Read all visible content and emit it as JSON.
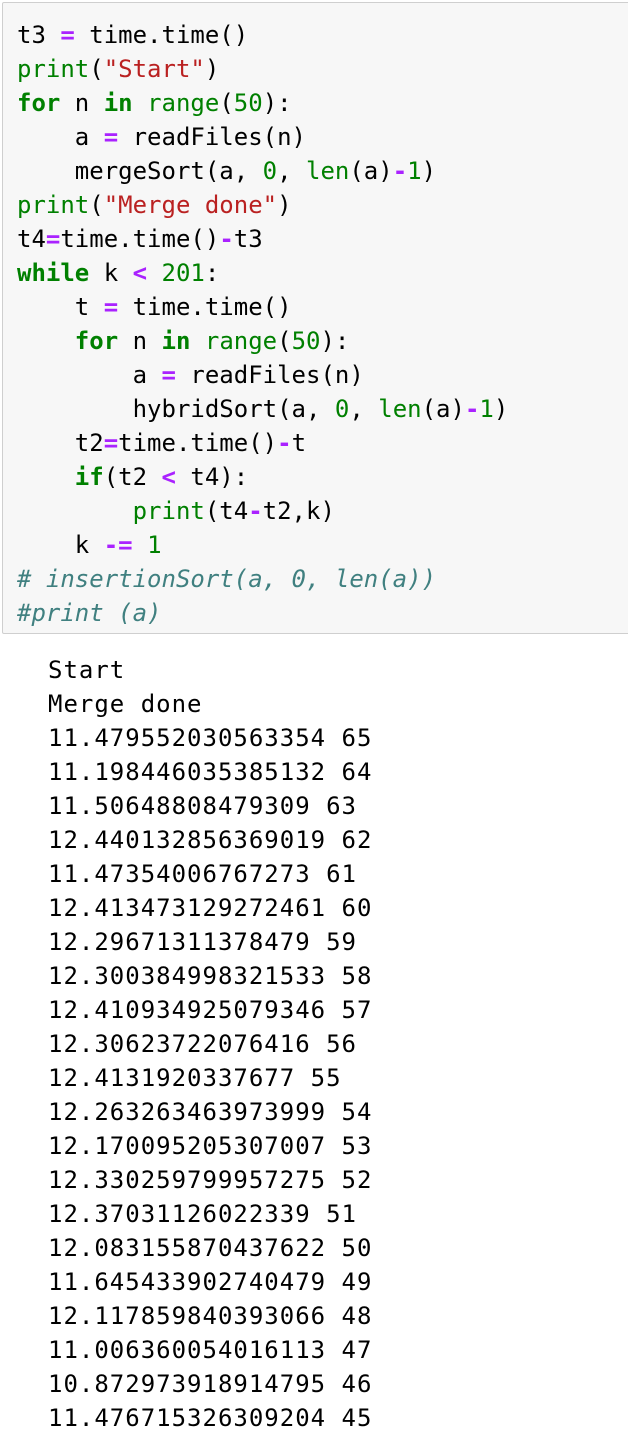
{
  "input_cell": {
    "lines": [
      [
        {
          "t": "t3 ",
          "c": "pl"
        },
        {
          "t": "=",
          "c": "op"
        },
        {
          "t": " time.time()",
          "c": "pl"
        }
      ],
      [
        {
          "t": "print",
          "c": "bi"
        },
        {
          "t": "(",
          "c": "pl"
        },
        {
          "t": "\"Start\"",
          "c": "str"
        },
        {
          "t": ")",
          "c": "pl"
        }
      ],
      [
        {
          "t": "for",
          "c": "kw"
        },
        {
          "t": " n ",
          "c": "pl"
        },
        {
          "t": "in",
          "c": "kw"
        },
        {
          "t": " ",
          "c": "pl"
        },
        {
          "t": "range",
          "c": "bi"
        },
        {
          "t": "(",
          "c": "pl"
        },
        {
          "t": "50",
          "c": "num"
        },
        {
          "t": "):",
          "c": "pl"
        }
      ],
      [
        {
          "t": "    a ",
          "c": "pl"
        },
        {
          "t": "=",
          "c": "op"
        },
        {
          "t": " readFiles(n)",
          "c": "pl"
        }
      ],
      [
        {
          "t": "    mergeSort(a, ",
          "c": "pl"
        },
        {
          "t": "0",
          "c": "num"
        },
        {
          "t": ", ",
          "c": "pl"
        },
        {
          "t": "len",
          "c": "bi"
        },
        {
          "t": "(a)",
          "c": "pl"
        },
        {
          "t": "-",
          "c": "op"
        },
        {
          "t": "1",
          "c": "num"
        },
        {
          "t": ")",
          "c": "pl"
        }
      ],
      [
        {
          "t": "print",
          "c": "bi"
        },
        {
          "t": "(",
          "c": "pl"
        },
        {
          "t": "\"Merge done\"",
          "c": "str"
        },
        {
          "t": ")",
          "c": "pl"
        }
      ],
      [
        {
          "t": "t4",
          "c": "pl"
        },
        {
          "t": "=",
          "c": "op"
        },
        {
          "t": "time.time()",
          "c": "pl"
        },
        {
          "t": "-",
          "c": "op"
        },
        {
          "t": "t3",
          "c": "pl"
        }
      ],
      [
        {
          "t": "while",
          "c": "kw"
        },
        {
          "t": " k ",
          "c": "pl"
        },
        {
          "t": "<",
          "c": "op"
        },
        {
          "t": " ",
          "c": "pl"
        },
        {
          "t": "201",
          "c": "num"
        },
        {
          "t": ":",
          "c": "pl"
        }
      ],
      [
        {
          "t": "    t ",
          "c": "pl"
        },
        {
          "t": "=",
          "c": "op"
        },
        {
          "t": " time.time()",
          "c": "pl"
        }
      ],
      [
        {
          "t": "    ",
          "c": "pl"
        },
        {
          "t": "for",
          "c": "kw"
        },
        {
          "t": " n ",
          "c": "pl"
        },
        {
          "t": "in",
          "c": "kw"
        },
        {
          "t": " ",
          "c": "pl"
        },
        {
          "t": "range",
          "c": "bi"
        },
        {
          "t": "(",
          "c": "pl"
        },
        {
          "t": "50",
          "c": "num"
        },
        {
          "t": "):",
          "c": "pl"
        }
      ],
      [
        {
          "t": "        a ",
          "c": "pl"
        },
        {
          "t": "=",
          "c": "op"
        },
        {
          "t": " readFiles(n)",
          "c": "pl"
        }
      ],
      [
        {
          "t": "        hybridSort(a, ",
          "c": "pl"
        },
        {
          "t": "0",
          "c": "num"
        },
        {
          "t": ", ",
          "c": "pl"
        },
        {
          "t": "len",
          "c": "bi"
        },
        {
          "t": "(a)",
          "c": "pl"
        },
        {
          "t": "-",
          "c": "op"
        },
        {
          "t": "1",
          "c": "num"
        },
        {
          "t": ")",
          "c": "pl"
        }
      ],
      [
        {
          "t": "    t2",
          "c": "pl"
        },
        {
          "t": "=",
          "c": "op"
        },
        {
          "t": "time.time()",
          "c": "pl"
        },
        {
          "t": "-",
          "c": "op"
        },
        {
          "t": "t",
          "c": "pl"
        }
      ],
      [
        {
          "t": "    ",
          "c": "pl"
        },
        {
          "t": "if",
          "c": "kw"
        },
        {
          "t": "(t2 ",
          "c": "pl"
        },
        {
          "t": "<",
          "c": "op"
        },
        {
          "t": " t4):",
          "c": "pl"
        }
      ],
      [
        {
          "t": "        ",
          "c": "pl"
        },
        {
          "t": "print",
          "c": "bi"
        },
        {
          "t": "(t4",
          "c": "pl"
        },
        {
          "t": "-",
          "c": "op"
        },
        {
          "t": "t2,k)",
          "c": "pl"
        }
      ],
      [
        {
          "t": "    k ",
          "c": "pl"
        },
        {
          "t": "-=",
          "c": "op"
        },
        {
          "t": " ",
          "c": "pl"
        },
        {
          "t": "1",
          "c": "num"
        }
      ],
      [
        {
          "t": "# insertionSort(a, 0, len(a))",
          "c": "cm"
        }
      ],
      [
        {
          "t": "#print (a)",
          "c": "cm"
        }
      ]
    ]
  },
  "output_cell": {
    "lines": [
      "Start",
      "Merge done",
      "11.479552030563354 65",
      "11.198446035385132 64",
      "11.50648808479309 63",
      "12.440132856369019 62",
      "11.47354006767273 61",
      "12.413473129272461 60",
      "12.29671311378479 59",
      "12.300384998321533 58",
      "12.410934925079346 57",
      "12.30623722076416 56",
      "12.4131920337677 55",
      "12.263263463973999 54",
      "12.170095205307007 53",
      "12.330259799957275 52",
      "12.37031126022339 51",
      "12.083155870437622 50",
      "11.645433902740479 49",
      "12.117859840393066 48",
      "11.006360054016113 47",
      "10.872973918914795 46",
      "11.476715326309204 45"
    ]
  }
}
